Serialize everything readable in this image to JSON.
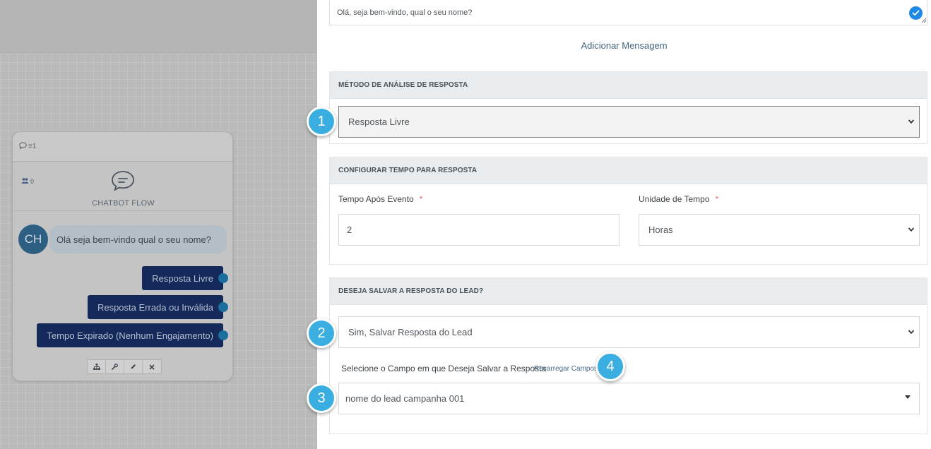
{
  "canvas": {
    "node": {
      "header_badge": "≡1",
      "contacts_count": "0",
      "flow_label": "CHATBOT FLOW",
      "avatar_initials": "CH",
      "message": "Olá seja bem-vindo qual o seu nome?",
      "options": [
        "Resposta Livre",
        "Resposta Errada ou Inválida",
        "Tempo Expirado (Nenhum Engajamento)"
      ],
      "toolbar_icons": [
        "sitemap-icon",
        "wrench-icon",
        "pencil-icon",
        "close-icon"
      ]
    }
  },
  "panel": {
    "message_text": "Olá, seja bem-vindo, qual o seu nome?",
    "add_message_label": "Adicionar Mensagem",
    "analysis_section": {
      "title": "MÉTODO DE ANÁLISE DE RESPOSTA",
      "selected": "Resposta Livre"
    },
    "timeout_section": {
      "title": "CONFIGURAR TEMPO PARA RESPOSTA",
      "time_label": "Tempo Após Evento",
      "time_value": "2",
      "unit_label": "Unidade de Tempo",
      "unit_selected": "Horas",
      "required_mark": "*"
    },
    "save_section": {
      "title": "DESEJA SALVAR A RESPOSTA DO LEAD?",
      "selected": "Sim, Salvar Resposta do Lead",
      "field_label": "Selecione o Campo em que Deseja Salvar a Resposta",
      "reload_link": "Recarregar Campos!",
      "field_selected": "nome do lead campanha 001"
    }
  },
  "markers": [
    "1",
    "2",
    "3",
    "4"
  ],
  "colors": {
    "marker": "#3aaee0",
    "option_bg": "#15295a",
    "check": "#1e88e5",
    "section_head": "#e9ecef"
  }
}
